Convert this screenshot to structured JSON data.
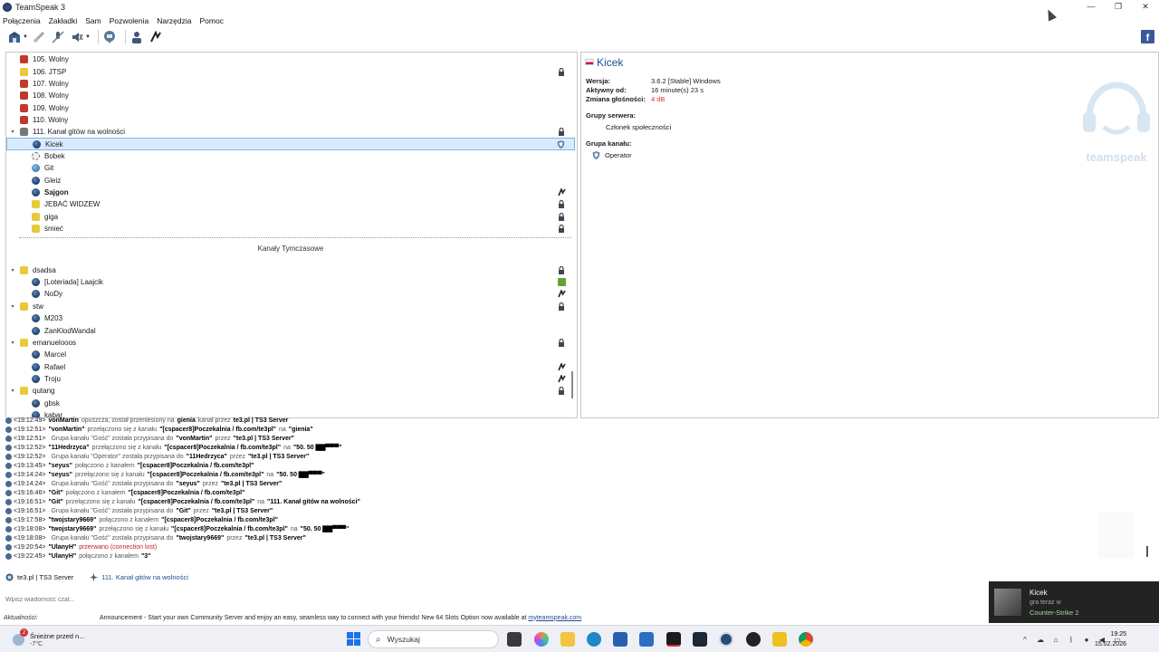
{
  "window": {
    "title": "TeamSpeak 3",
    "minimize": "—",
    "maximize": "❐",
    "close": "✕"
  },
  "menu": [
    "Połączenia",
    "Zakładki",
    "Sam",
    "Pozwolenia",
    "Narzędzia",
    "Pomoc"
  ],
  "toolbar": {
    "facebook_label": "f"
  },
  "tree": {
    "channels_top": [
      {
        "name": "105. Wolny",
        "color": "red",
        "locked": false
      },
      {
        "name": "106. JTSP",
        "color": "yellow",
        "locked": true
      },
      {
        "name": "107. Wolny",
        "color": "red",
        "locked": false
      },
      {
        "name": "108. Wolny",
        "color": "red",
        "locked": false
      },
      {
        "name": "109. Wolny",
        "color": "red",
        "locked": false
      },
      {
        "name": "110. Wolny",
        "color": "red",
        "locked": false
      }
    ],
    "expanded_channel": {
      "name": "111. Kanał gitów na wolności",
      "locked": true
    },
    "clients_111": [
      {
        "name": "Kicek",
        "selected": true,
        "right": "shield"
      },
      {
        "name": "Bobek",
        "muted": true
      },
      {
        "name": "Git",
        "light": true
      },
      {
        "name": "Gleiz"
      },
      {
        "name": "Sajgon",
        "bold": true,
        "right": "flag"
      }
    ],
    "subchannels_111": [
      {
        "name": "JEBAĆ WIDZEW",
        "locked": true
      },
      {
        "name": "giga",
        "locked": true
      },
      {
        "name": "śmieć",
        "locked": true
      }
    ],
    "spacer": "Kanały Tymczasowe",
    "temp_channels": [
      {
        "name": "dsadsa",
        "locked": true,
        "clients": [
          {
            "name": "[Loteriada] Laajcik",
            "right": "badge"
          },
          {
            "name": "NoDy",
            "right": "flag"
          }
        ]
      },
      {
        "name": "stw",
        "locked": true,
        "clients": [
          {
            "name": "M203"
          },
          {
            "name": "ZanKlodWandal"
          }
        ]
      },
      {
        "name": "emanuelooos",
        "locked": true,
        "clients": [
          {
            "name": "Marcel"
          },
          {
            "name": "Rafael",
            "right": "flag"
          },
          {
            "name": "Troju",
            "right": "flag"
          }
        ]
      },
      {
        "name": "qutang",
        "locked": true,
        "clients": [
          {
            "name": "gbsk"
          },
          {
            "name": "kabar"
          }
        ]
      }
    ]
  },
  "info": {
    "name": "Kicek",
    "version_label": "Wersja:",
    "version": "3.6.2 [Stable] Windows",
    "online_label": "Aktywny od:",
    "online": "16 minute(s) 23 s",
    "volume_label": "Zmiana głośności:",
    "volume": "4 dB",
    "server_groups_label": "Grupy serwera:",
    "server_group": "Członek społeczności",
    "channel_group_label": "Grupa kanału:",
    "channel_group": "Operator",
    "logo_text": "teamspeak"
  },
  "log": [
    {
      "time": "<19:12:49>",
      "parts": [
        [
          "b",
          "vonMartin"
        ],
        [
          "g",
          "opuszcza, został przeniesiony na"
        ],
        [
          "b",
          "gienia"
        ],
        [
          "g",
          "kanał przez"
        ],
        [
          "b",
          "te3.pl | TS3 Server"
        ]
      ]
    },
    {
      "time": "<19:12:51>",
      "parts": [
        [
          "b",
          "\"vonMartin\""
        ],
        [
          "g",
          "przełączono się z kanału"
        ],
        [
          "b",
          "\"[cspacer8]Poczekalnia / fb.com/te3pl\""
        ],
        [
          "g",
          "na"
        ],
        [
          "b",
          "\"gienia\""
        ]
      ]
    },
    {
      "time": "<19:12:51>",
      "parts": [
        [
          "g",
          "Grupa kanału \"Gość\" została przypisana do"
        ],
        [
          "b",
          "\"vonMartin\""
        ],
        [
          "g",
          "przez"
        ],
        [
          "b",
          "\"te3.pl | TS3 Server\""
        ]
      ]
    },
    {
      "time": "<19:12:52>",
      "parts": [
        [
          "b",
          "\"11Hedrzyca\""
        ],
        [
          "g",
          "przełączono się z kanału"
        ],
        [
          "b",
          "\"[cspacer8]Poczekalnia / fb.com/te3pl\""
        ],
        [
          "g",
          "na"
        ],
        [
          "b",
          "\"50. 50 ▇▇▀▀▀\""
        ]
      ]
    },
    {
      "time": "<19:12:52>",
      "parts": [
        [
          "g",
          "Grupa kanału \"Operator\" została przypisana do"
        ],
        [
          "b",
          "\"11Hedrzyca\""
        ],
        [
          "g",
          "przez"
        ],
        [
          "b",
          "\"te3.pl | TS3 Server\""
        ]
      ]
    },
    {
      "time": "<19:13:45>",
      "parts": [
        [
          "b",
          "\"seyus\""
        ],
        [
          "g",
          "połączono z kanałem"
        ],
        [
          "b",
          "\"[cspacer8]Poczekalnia / fb.com/te3pl\""
        ]
      ]
    },
    {
      "time": "<19:14:24>",
      "parts": [
        [
          "b",
          "\"seyus\""
        ],
        [
          "g",
          "przełączono się z kanału"
        ],
        [
          "b",
          "\"[cspacer8]Poczekalnia / fb.com/te3pl\""
        ],
        [
          "g",
          "na"
        ],
        [
          "b",
          "\"50. 50 ▇▇▀▀▀\""
        ]
      ]
    },
    {
      "time": "<19:14:24>",
      "parts": [
        [
          "g",
          "Grupa kanału \"Gość\" została przypisana do"
        ],
        [
          "b",
          "\"seyus\""
        ],
        [
          "g",
          "przez"
        ],
        [
          "b",
          "\"te3.pl | TS3 Server\""
        ]
      ]
    },
    {
      "time": "<19:16:46>",
      "parts": [
        [
          "b",
          "\"Git\""
        ],
        [
          "g",
          "połączono z kanałem"
        ],
        [
          "b",
          "\"[cspacer8]Poczekalnia / fb.com/te3pl\""
        ]
      ]
    },
    {
      "time": "<19:16:51>",
      "parts": [
        [
          "b",
          "\"Git\""
        ],
        [
          "g",
          "przełączono się z kanału"
        ],
        [
          "b",
          "\"[cspacer8]Poczekalnia / fb.com/te3pl\""
        ],
        [
          "g",
          "na"
        ],
        [
          "b",
          "\"111. Kanał gitów na wolności\""
        ]
      ]
    },
    {
      "time": "<19:16:51>",
      "parts": [
        [
          "g",
          "Grupa kanału \"Gość\" została przypisana do"
        ],
        [
          "b",
          "\"Git\""
        ],
        [
          "g",
          "przez"
        ],
        [
          "b",
          "\"te3.pl | TS3 Server\""
        ]
      ]
    },
    {
      "time": "<19:17:58>",
      "parts": [
        [
          "b",
          "\"twojstary9669\""
        ],
        [
          "g",
          "połączono z kanałem"
        ],
        [
          "b",
          "\"[cspacer8]Poczekalnia / fb.com/te3pl\""
        ]
      ]
    },
    {
      "time": "<19:18:08>",
      "parts": [
        [
          "b",
          "\"twojstary9669\""
        ],
        [
          "g",
          "przełączono się z kanału"
        ],
        [
          "b",
          "\"[cspacer8]Poczekalnia / fb.com/te3pl\""
        ],
        [
          "g",
          "na"
        ],
        [
          "b",
          "\"50. 50 ▇▇▀▀▀\""
        ]
      ]
    },
    {
      "time": "<19:18:08>",
      "parts": [
        [
          "g",
          "Grupa kanału \"Gość\" została przypisana do"
        ],
        [
          "b",
          "\"twojstary9669\""
        ],
        [
          "g",
          "przez"
        ],
        [
          "b",
          "\"te3.pl | TS3 Server\""
        ]
      ]
    },
    {
      "time": "<19:20:54>",
      "parts": [
        [
          "b",
          "\"UlanyH\""
        ],
        [
          "err",
          "przerwano (connection lost)"
        ]
      ]
    },
    {
      "time": "<19:22:45>",
      "parts": [
        [
          "b",
          "\"UlanyH\""
        ],
        [
          "g",
          "połączono z kanałem"
        ],
        [
          "b",
          "\"3\""
        ]
      ]
    }
  ],
  "tabs": [
    {
      "label": "te3.pl | TS3 Server",
      "active": true
    },
    {
      "label": "111. Kanał gitów na wolności",
      "active": false
    }
  ],
  "chat_input": {
    "placeholder": "Wpisz wiadomość czat..."
  },
  "status": {
    "label": "Aktualności:",
    "announcement": "Announcement - Start your own Community Server and enjoy an easy, seamless way to connect with your friends! New 64 Slots Option now available at",
    "link": "myteamspeak.com"
  },
  "notification": {
    "name": "Kicek",
    "line2": "gra teraz w",
    "game": "Counter-Strike 2"
  },
  "taskbar": {
    "weather_title": "Śnieżne przed n...",
    "weather_temp": "-7°C",
    "badge": "2",
    "search": "Wyszukaj",
    "time": "19:25",
    "date": "15.02.2026"
  }
}
